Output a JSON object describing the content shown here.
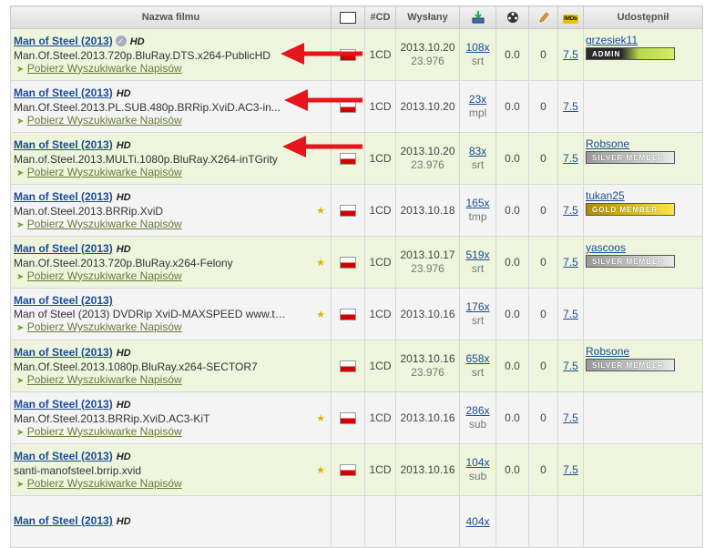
{
  "headers": {
    "name": "Nazwa filmu",
    "cd": "#CD",
    "sent": "Wysłany",
    "share": "Udostępnił",
    "imdb_icon": "IMDb"
  },
  "download_link_label": "Pobierz Wyszukiwarke Napisów",
  "rows": [
    {
      "title": "Man of Steel (2013)",
      "hd": "HD",
      "verified": true,
      "release": "Man.Of.Steel.2013.720p.BluRay.DTS.x264-PublicHD",
      "star": false,
      "cd": "1CD",
      "date": "2013.10.20",
      "fps": "23.976",
      "downloads": "108x",
      "format": "srt",
      "rating": "0.0",
      "votes": "0",
      "imdb": "7.5",
      "user": "grzesiek11",
      "badge": "ADMIN",
      "badge_type": "admin"
    },
    {
      "title": "Man of Steel (2013)",
      "hd": "HD",
      "verified": false,
      "release": "Man.Of.Steel.2013.PL.SUB.480p.BRRip.XviD.AC3-in...",
      "star": false,
      "cd": "1CD",
      "date": "2013.10.20",
      "fps": "",
      "downloads": "23x",
      "format": "mpl",
      "rating": "0.0",
      "votes": "0",
      "imdb": "7.5",
      "user": "",
      "badge": "",
      "badge_type": ""
    },
    {
      "title": "Man of Steel (2013)",
      "hd": "HD",
      "verified": false,
      "release": "Man.of.Steel.2013.MULTi.1080p.BluRay.X264-inTGrity",
      "star": false,
      "cd": "1CD",
      "date": "2013.10.20",
      "fps": "23.976",
      "downloads": "83x",
      "format": "srt",
      "rating": "0.0",
      "votes": "0",
      "imdb": "7.5",
      "user": "Robsone",
      "badge": "SILVER MEMBER",
      "badge_type": "silver"
    },
    {
      "title": "Man of Steel (2013)",
      "hd": "HD",
      "verified": false,
      "release": "Man.of.Steel.2013.BRRip.XviD",
      "star": true,
      "cd": "1CD",
      "date": "2013.10.18",
      "fps": "",
      "downloads": "165x",
      "format": "tmp",
      "rating": "0.0",
      "votes": "0",
      "imdb": "7.5",
      "user": "tukan25",
      "badge": "GOLD MEMBER",
      "badge_type": "gold"
    },
    {
      "title": "Man of Steel (2013)",
      "hd": "HD",
      "verified": false,
      "release": "Man.Of.Steel.2013.720p.BluRay.x264-Felony",
      "star": true,
      "cd": "1CD",
      "date": "2013.10.17",
      "fps": "23.976",
      "downloads": "519x",
      "format": "srt",
      "rating": "0.0",
      "votes": "0",
      "imdb": "7.5",
      "user": "yascoos",
      "badge": "SILVER MEMBER",
      "badge_type": "silver"
    },
    {
      "title": "Man of Steel (2013)",
      "hd": "",
      "verified": false,
      "release": "Man of Steel (2013) DVDRip XviD-MAXSPEED www.to...",
      "star": true,
      "cd": "1CD",
      "date": "2013.10.16",
      "fps": "",
      "downloads": "176x",
      "format": "srt",
      "rating": "0.0",
      "votes": "0",
      "imdb": "7.5",
      "user": "",
      "badge": "",
      "badge_type": ""
    },
    {
      "title": "Man of Steel (2013)",
      "hd": "HD",
      "verified": false,
      "release": "Man.Of.Steel.2013.1080p.BluRay.x264-SECTOR7",
      "star": false,
      "cd": "1CD",
      "date": "2013.10.16",
      "fps": "23.976",
      "downloads": "658x",
      "format": "srt",
      "rating": "0.0",
      "votes": "0",
      "imdb": "7.5",
      "user": "Robsone",
      "badge": "SILVER MEMBER",
      "badge_type": "silver"
    },
    {
      "title": "Man of Steel (2013)",
      "hd": "HD",
      "verified": false,
      "release": "Man.Of.Steel.2013.BRRip.XviD.AC3-KiT",
      "star": true,
      "cd": "1CD",
      "date": "2013.10.16",
      "fps": "",
      "downloads": "286x",
      "format": "sub",
      "rating": "0.0",
      "votes": "0",
      "imdb": "7.5",
      "user": "",
      "badge": "",
      "badge_type": ""
    },
    {
      "title": "Man of Steel (2013)",
      "hd": "HD",
      "verified": false,
      "release": "santi-manofsteel.brrip.xvid",
      "star": true,
      "cd": "1CD",
      "date": "2013.10.16",
      "fps": "",
      "downloads": "104x",
      "format": "sub",
      "rating": "0.0",
      "votes": "0",
      "imdb": "7.5",
      "user": "",
      "badge": "",
      "badge_type": ""
    },
    {
      "title": "Man of Steel (2013)",
      "hd": "HD",
      "verified": false,
      "release": "",
      "star": false,
      "cd": "",
      "date": "",
      "fps": "",
      "downloads": "404x",
      "format": "",
      "rating": "",
      "votes": "",
      "imdb": "",
      "user": "",
      "badge": "",
      "badge_type": ""
    }
  ],
  "colors": {
    "arrow": "#e8141c",
    "link": "#1a4c96",
    "row_odd": "#eef5dc",
    "row_even": "#f4f4f4"
  }
}
